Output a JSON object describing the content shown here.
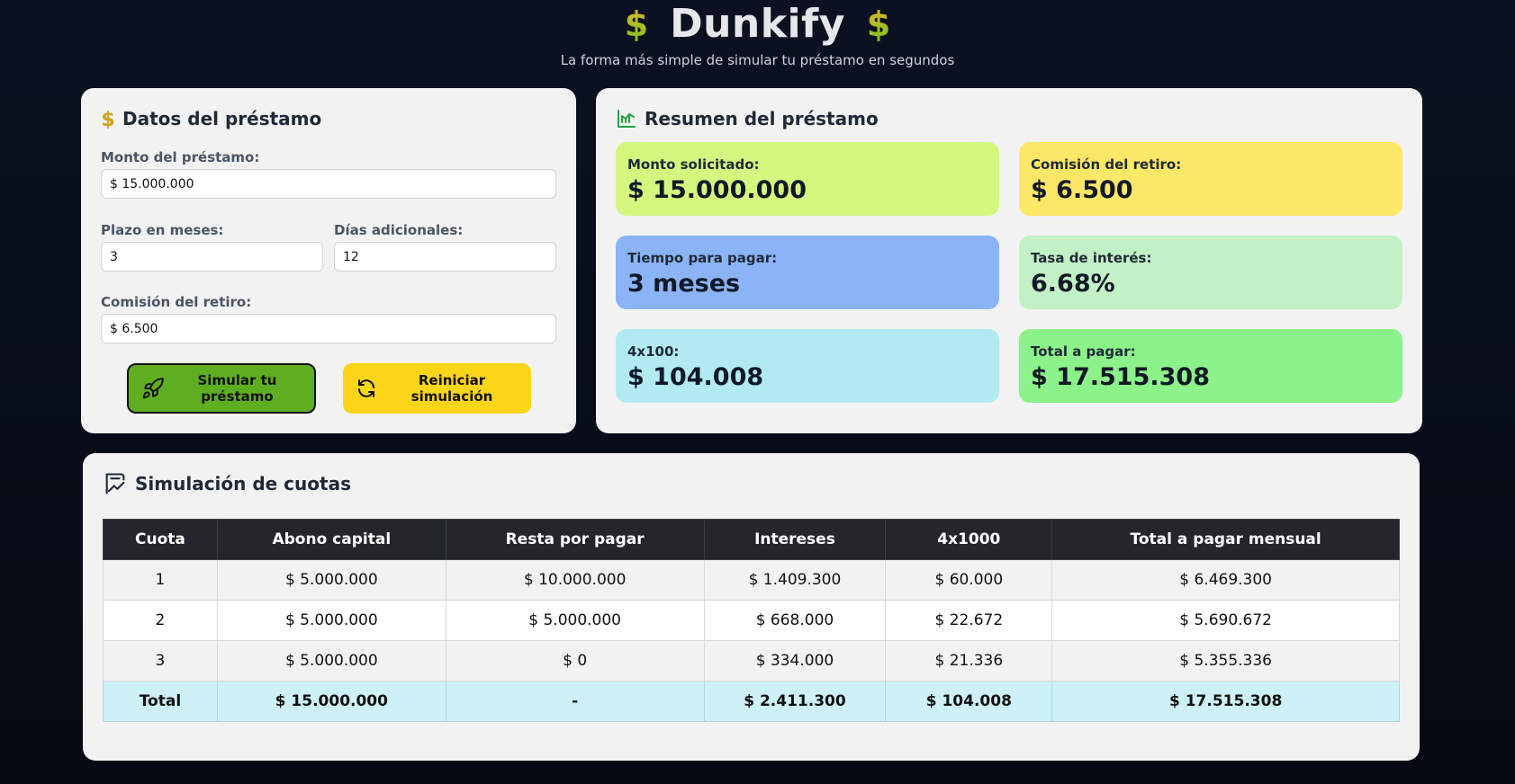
{
  "app": {
    "title": "Dunkify",
    "subtitle": "La forma más simple de simular tu préstamo en segundos"
  },
  "form": {
    "title": "Datos del préstamo",
    "monto_label": "Monto del préstamo:",
    "monto_value": "$ 15.000.000",
    "plazo_label": "Plazo en meses:",
    "plazo_value": "3",
    "dias_label": "Días adicionales:",
    "dias_value": "12",
    "comision_label": "Comisión del retiro:",
    "comision_value": "$ 6.500",
    "simulate_label": "Simular tu préstamo",
    "reset_label": "Reiniciar simulación"
  },
  "summary": {
    "title": "Resumen del préstamo",
    "tiles": [
      {
        "label": "Monto solicitado:",
        "value": "$ 15.000.000",
        "color": "#d4f87f"
      },
      {
        "label": "Comisión del retiro:",
        "value": "$ 6.500",
        "color": "#fde767"
      },
      {
        "label": "Tiempo para pagar:",
        "value": "3 meses",
        "color": "#8bb4f7"
      },
      {
        "label": "Tasa de interés:",
        "value": "6.68%",
        "color": "#c2f1c6"
      },
      {
        "label": "4x100:",
        "value": "$ 104.008",
        "color": "#b1ebf1"
      },
      {
        "label": "Total a pagar:",
        "value": "$ 17.515.308",
        "color": "#8cf28a"
      }
    ]
  },
  "table": {
    "title": "Simulación de cuotas",
    "headers": [
      "Cuota",
      "Abono capital",
      "Resta por pagar",
      "Intereses",
      "4x1000",
      "Total a pagar mensual"
    ],
    "rows": [
      [
        "1",
        "$ 5.000.000",
        "$ 10.000.000",
        "$ 1.409.300",
        "$ 60.000",
        "$ 6.469.300"
      ],
      [
        "2",
        "$ 5.000.000",
        "$ 5.000.000",
        "$ 668.000",
        "$ 22.672",
        "$ 5.690.672"
      ],
      [
        "3",
        "$ 5.000.000",
        "$ 0",
        "$ 334.000",
        "$ 21.336",
        "$ 5.355.336"
      ]
    ],
    "total": [
      "Total",
      "$ 15.000.000",
      "-",
      "$ 2.411.300",
      "$ 104.008",
      "$ 17.515.308"
    ]
  },
  "colors": {
    "accent_green": "#5fae21",
    "accent_yellow": "#fbd518",
    "dollar_gold": "#d4a017",
    "dollar_green": "#7cc520"
  }
}
